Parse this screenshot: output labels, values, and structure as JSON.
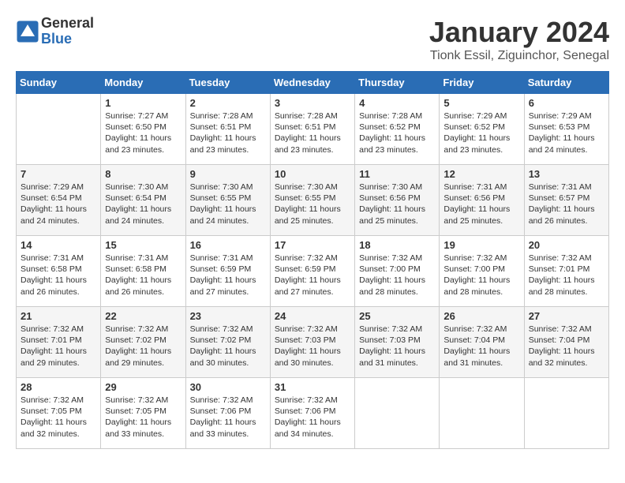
{
  "logo": {
    "general": "General",
    "blue": "Blue"
  },
  "title": "January 2024",
  "location": "Tionk Essil, Ziguinchor, Senegal",
  "days_of_week": [
    "Sunday",
    "Monday",
    "Tuesday",
    "Wednesday",
    "Thursday",
    "Friday",
    "Saturday"
  ],
  "weeks": [
    [
      {
        "day": "",
        "info": ""
      },
      {
        "day": "1",
        "info": "Sunrise: 7:27 AM\nSunset: 6:50 PM\nDaylight: 11 hours\nand 23 minutes."
      },
      {
        "day": "2",
        "info": "Sunrise: 7:28 AM\nSunset: 6:51 PM\nDaylight: 11 hours\nand 23 minutes."
      },
      {
        "day": "3",
        "info": "Sunrise: 7:28 AM\nSunset: 6:51 PM\nDaylight: 11 hours\nand 23 minutes."
      },
      {
        "day": "4",
        "info": "Sunrise: 7:28 AM\nSunset: 6:52 PM\nDaylight: 11 hours\nand 23 minutes."
      },
      {
        "day": "5",
        "info": "Sunrise: 7:29 AM\nSunset: 6:52 PM\nDaylight: 11 hours\nand 23 minutes."
      },
      {
        "day": "6",
        "info": "Sunrise: 7:29 AM\nSunset: 6:53 PM\nDaylight: 11 hours\nand 24 minutes."
      }
    ],
    [
      {
        "day": "7",
        "info": "Sunrise: 7:29 AM\nSunset: 6:54 PM\nDaylight: 11 hours\nand 24 minutes."
      },
      {
        "day": "8",
        "info": "Sunrise: 7:30 AM\nSunset: 6:54 PM\nDaylight: 11 hours\nand 24 minutes."
      },
      {
        "day": "9",
        "info": "Sunrise: 7:30 AM\nSunset: 6:55 PM\nDaylight: 11 hours\nand 24 minutes."
      },
      {
        "day": "10",
        "info": "Sunrise: 7:30 AM\nSunset: 6:55 PM\nDaylight: 11 hours\nand 25 minutes."
      },
      {
        "day": "11",
        "info": "Sunrise: 7:30 AM\nSunset: 6:56 PM\nDaylight: 11 hours\nand 25 minutes."
      },
      {
        "day": "12",
        "info": "Sunrise: 7:31 AM\nSunset: 6:56 PM\nDaylight: 11 hours\nand 25 minutes."
      },
      {
        "day": "13",
        "info": "Sunrise: 7:31 AM\nSunset: 6:57 PM\nDaylight: 11 hours\nand 26 minutes."
      }
    ],
    [
      {
        "day": "14",
        "info": "Sunrise: 7:31 AM\nSunset: 6:58 PM\nDaylight: 11 hours\nand 26 minutes."
      },
      {
        "day": "15",
        "info": "Sunrise: 7:31 AM\nSunset: 6:58 PM\nDaylight: 11 hours\nand 26 minutes."
      },
      {
        "day": "16",
        "info": "Sunrise: 7:31 AM\nSunset: 6:59 PM\nDaylight: 11 hours\nand 27 minutes."
      },
      {
        "day": "17",
        "info": "Sunrise: 7:32 AM\nSunset: 6:59 PM\nDaylight: 11 hours\nand 27 minutes."
      },
      {
        "day": "18",
        "info": "Sunrise: 7:32 AM\nSunset: 7:00 PM\nDaylight: 11 hours\nand 28 minutes."
      },
      {
        "day": "19",
        "info": "Sunrise: 7:32 AM\nSunset: 7:00 PM\nDaylight: 11 hours\nand 28 minutes."
      },
      {
        "day": "20",
        "info": "Sunrise: 7:32 AM\nSunset: 7:01 PM\nDaylight: 11 hours\nand 28 minutes."
      }
    ],
    [
      {
        "day": "21",
        "info": "Sunrise: 7:32 AM\nSunset: 7:01 PM\nDaylight: 11 hours\nand 29 minutes."
      },
      {
        "day": "22",
        "info": "Sunrise: 7:32 AM\nSunset: 7:02 PM\nDaylight: 11 hours\nand 29 minutes."
      },
      {
        "day": "23",
        "info": "Sunrise: 7:32 AM\nSunset: 7:02 PM\nDaylight: 11 hours\nand 30 minutes."
      },
      {
        "day": "24",
        "info": "Sunrise: 7:32 AM\nSunset: 7:03 PM\nDaylight: 11 hours\nand 30 minutes."
      },
      {
        "day": "25",
        "info": "Sunrise: 7:32 AM\nSunset: 7:03 PM\nDaylight: 11 hours\nand 31 minutes."
      },
      {
        "day": "26",
        "info": "Sunrise: 7:32 AM\nSunset: 7:04 PM\nDaylight: 11 hours\nand 31 minutes."
      },
      {
        "day": "27",
        "info": "Sunrise: 7:32 AM\nSunset: 7:04 PM\nDaylight: 11 hours\nand 32 minutes."
      }
    ],
    [
      {
        "day": "28",
        "info": "Sunrise: 7:32 AM\nSunset: 7:05 PM\nDaylight: 11 hours\nand 32 minutes."
      },
      {
        "day": "29",
        "info": "Sunrise: 7:32 AM\nSunset: 7:05 PM\nDaylight: 11 hours\nand 33 minutes."
      },
      {
        "day": "30",
        "info": "Sunrise: 7:32 AM\nSunset: 7:06 PM\nDaylight: 11 hours\nand 33 minutes."
      },
      {
        "day": "31",
        "info": "Sunrise: 7:32 AM\nSunset: 7:06 PM\nDaylight: 11 hours\nand 34 minutes."
      },
      {
        "day": "",
        "info": ""
      },
      {
        "day": "",
        "info": ""
      },
      {
        "day": "",
        "info": ""
      }
    ]
  ]
}
